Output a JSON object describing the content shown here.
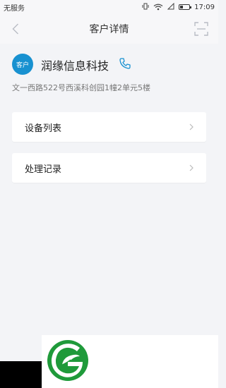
{
  "status_bar": {
    "carrier": "无服务",
    "time": "17:09"
  },
  "nav": {
    "title": "客户详情"
  },
  "customer": {
    "badge": "客户",
    "name": "润缘信息科技",
    "address": "文一西路522号西溪科创园1幢2单元5楼"
  },
  "menu": [
    {
      "label": "设备列表"
    },
    {
      "label": "处理记录"
    }
  ],
  "colors": {
    "accent": "#1891d0",
    "logo_green": "#1f9a3a"
  }
}
